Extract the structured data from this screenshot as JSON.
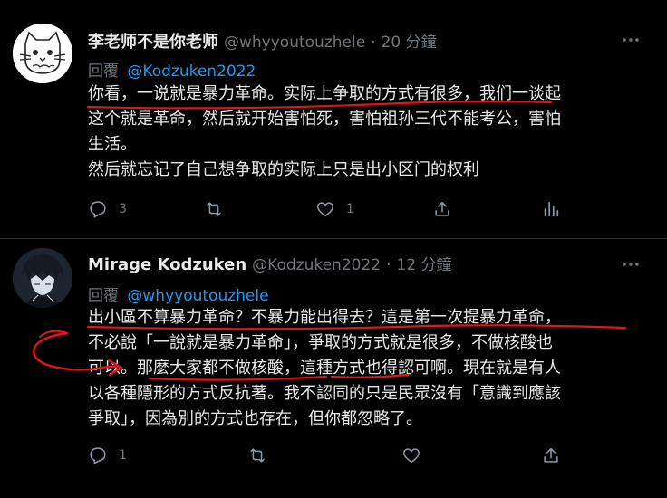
{
  "tweets": [
    {
      "author": {
        "display_name": "李老师不是你老师",
        "handle": "@whyyoutouzhele"
      },
      "separator": "·",
      "timestamp": "20 分鐘",
      "replying_label": "回覆",
      "replying_to": "@Kodzuken2022",
      "text_lines": [
        "你看，一说就是暴力革命。实际上争取的方式有很多，我们一谈起",
        "这个就是革命，然后就开始害怕死，害怕祖孙三代不能考公，害怕",
        "生活。",
        "然后就忘记了自己想争取的实际上只是出小区门的权利"
      ],
      "counts": {
        "reply": "3",
        "retweet": "",
        "like": "1"
      },
      "avatar_icon": "doodle-cat-avatar"
    },
    {
      "author": {
        "display_name": "Mirage Kodzuken",
        "handle": "@Kodzuken2022"
      },
      "separator": "·",
      "timestamp": "12 分鐘",
      "replying_label": "回覆",
      "replying_to": "@whyyoutouzhele",
      "text_lines": [
        "出小區不算暴力革命？不暴力能出得去？這是第一次提暴力革命，",
        "不必說「一說就是暴力革命」，爭取的方式就是很多，不做核酸也",
        "可以。那麼大家都不做核酸，這種方式也得認可啊。現在就是有人",
        "以各種隱形的方式反抗著。我不認同的只是民眾沒有「意識到應該",
        "爭取」，因為別的方式也存在，但你都忽略了。"
      ],
      "counts": {
        "reply": "1",
        "retweet": "",
        "like": ""
      },
      "avatar_icon": "anime-character-avatar"
    }
  ],
  "colors": {
    "background": "#000000",
    "text": "#e7e9ea",
    "muted": "#71767b",
    "link": "#1d9bf0",
    "annotation": "#e0161b",
    "divider": "#2f3336"
  },
  "icons": [
    "reply-icon",
    "retweet-icon",
    "like-icon",
    "share-icon",
    "analytics-icon",
    "more-icon"
  ]
}
